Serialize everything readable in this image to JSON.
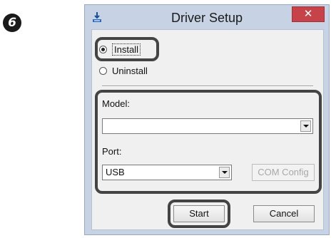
{
  "step": {
    "number": "6"
  },
  "window": {
    "title": "Driver Setup",
    "close_glyph": "✕"
  },
  "mode": {
    "options": [
      {
        "label": "Install",
        "selected": true
      },
      {
        "label": "Uninstall",
        "selected": false
      }
    ]
  },
  "model": {
    "label": "Model:",
    "value": ""
  },
  "port": {
    "label": "Port:",
    "value": "USB"
  },
  "buttons": {
    "com_config": "COM Config",
    "start": "Start",
    "cancel": "Cancel"
  },
  "icons": {
    "close": "close-icon",
    "app": "app-icon",
    "dropdown": "chevron-down-icon"
  },
  "colors": {
    "window_frame": "#c7d3e4",
    "close_button": "#c7434a",
    "highlight_border": "#444444",
    "client_bg": "#f0f0f0"
  }
}
